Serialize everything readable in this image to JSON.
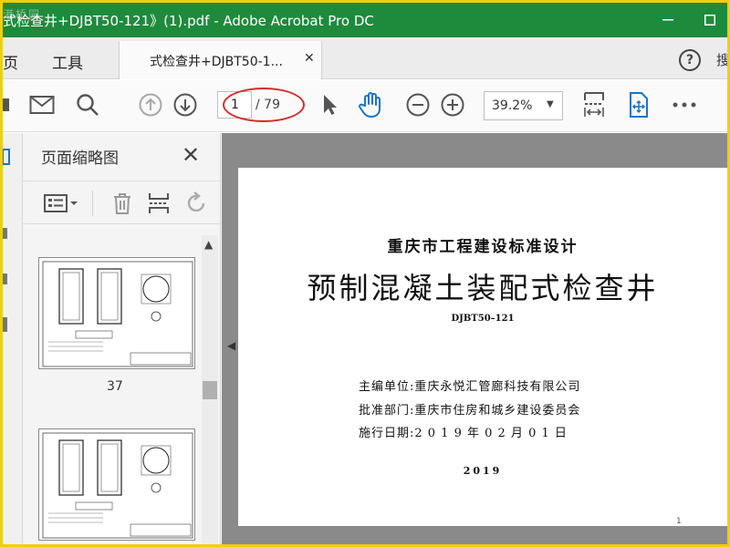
{
  "window": {
    "title": "式检查井+DJBT50-121》(1).pdf - Adobe Acrobat Pro DC",
    "watermark": "港桥园"
  },
  "tabs": {
    "home_label": "页",
    "tools_label": "工具",
    "document_tab_label": "式检查井+DJBT50-1...",
    "edge_char": "搜"
  },
  "toolbar": {
    "current_page": "1",
    "total_pages": "/ 79",
    "zoom": "39.2%"
  },
  "panel": {
    "title": "页面缩略图",
    "thumbnails": [
      {
        "page": "37"
      },
      {
        "page": ""
      }
    ]
  },
  "document": {
    "subtitle": "重庆市工程建设标准设计",
    "title": "预制混凝土装配式检查井",
    "code": "DJBT50–121",
    "editor_line": "主编单位:重庆永悦汇管廊科技有限公司",
    "approver_line": "批准部门:重庆市住房和城乡建设委员会",
    "date_line": "施行日期:2 0 1 9 年 0 2 月 0 1 日",
    "year": "2019",
    "page_number": "1"
  },
  "colors": {
    "titlebar": "#1e8a3c",
    "frame": "#f0cf0e",
    "annotation": "#d22b2b",
    "accent_blue": "#1a73c9"
  }
}
